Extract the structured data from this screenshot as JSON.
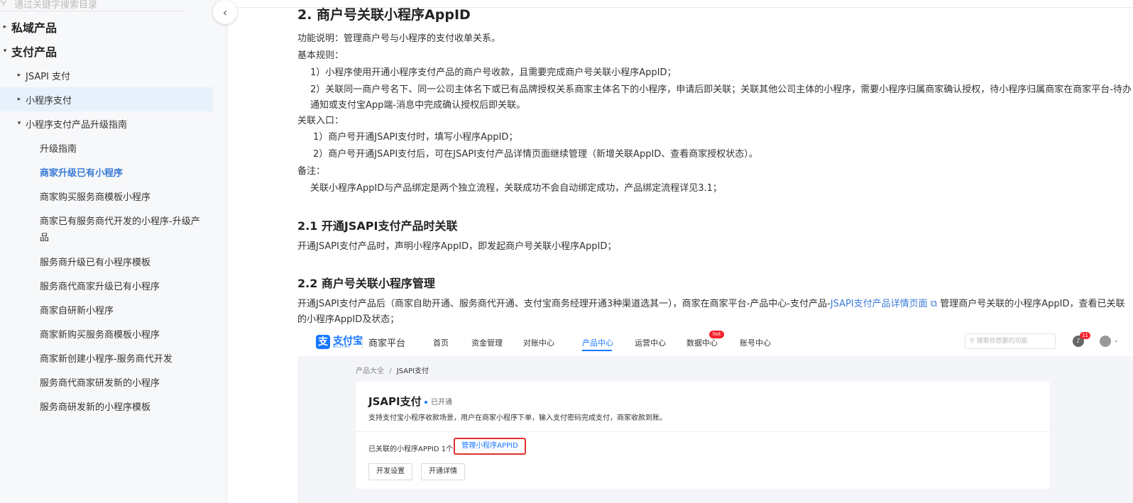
{
  "sidebar": {
    "search_placeholder": "通过关键字搜索目录",
    "items": [
      {
        "label": "私域产品",
        "level": 0,
        "caret": "▸"
      },
      {
        "label": "支付产品",
        "level": 0,
        "caret": "▾"
      },
      {
        "label": "JSAPI 支付",
        "level": 1,
        "caret": "▸"
      },
      {
        "label": "小程序支付",
        "level": 1,
        "caret": "▸"
      },
      {
        "label": "小程序支付产品升级指南",
        "level": 1,
        "caret": "▾"
      },
      {
        "label": "升级指南",
        "level": 2
      },
      {
        "label": "商家升级已有小程序",
        "level": 2
      },
      {
        "label": "商家购买服务商模板小程序",
        "level": 2
      },
      {
        "label": "商家已有服务商代开发的小程序-升级产品",
        "level": 2
      },
      {
        "label": "服务商升级已有小程序模板",
        "level": 2
      },
      {
        "label": "服务商代商家升级已有小程序",
        "level": 2
      },
      {
        "label": "商家自研新小程序",
        "level": 2
      },
      {
        "label": "商家新购买服务商模板小程序",
        "level": 2
      },
      {
        "label": "商家新创建小程序-服务商代开发",
        "level": 2
      },
      {
        "label": "服务商代商家研发新的小程序",
        "level": 2
      },
      {
        "label": "服务商研发新的小程序模板",
        "level": 2
      }
    ],
    "collapse_glyph": "‹"
  },
  "article": {
    "title": "2. 商户号关联小程序AppID",
    "func_desc": "功能说明：管理商户号与小程序的支付收单关系。",
    "basic_rules": "基本规则：",
    "rule1": "1）小程序使用开通小程序支付产品的商户号收款，且需要完成商户号关联小程序AppID；",
    "rule2": "2）关联同一商户号名下、同一公司主体名下或已有品牌授权关系商家主体名下的小程序，申请后即关联；关联其他公司主体的小程序，需要小程序归属商家确认授权，待小程序归属商家在商家平台-待办通知或支付宝App端-消息中完成确认授权后即关联。",
    "entry": "关联入口：",
    "entry1": "1）商户号开通JSAPI支付时，填写小程序AppID；",
    "entry2": "2）商户号开通JSAPI支付后，可在JSAPI支付产品详情页面继续管理（新增关联AppID、查看商家授权状态）。",
    "note": "备注：",
    "note_text": "关联小程序AppID与产品绑定是两个独立流程，关联成功不会自动绑定成功，产品绑定流程详见3.1；",
    "h21": "2.1 开通JSAPI支付产品时关联",
    "p21": "开通JSAPI支付产品时，声明小程序AppID，即发起商户号关联小程序AppID；",
    "h22": "2.2 商户号关联小程序管理",
    "p22_pre": "开通JSAPI支付产品后（商家自助开通、服务商代开通、支付宝商务经理开通3种渠道选其一），商家在商家平台-产品中心-支付产品-",
    "p22_link": "JSAPI支付产品详情页面",
    "p22_post": " 管理商户号关联的小程序AppID，查看已关联的小程序AppID及状态；"
  },
  "screenshot": {
    "logo_mark": "支",
    "logo_text": "支付宝",
    "logo_sub": "ALIPAY",
    "platform": "商家平台",
    "menu": [
      "首页",
      "资金管理",
      "对账中心",
      "产品中心",
      "运营中心",
      "数据中心",
      "账号中心"
    ],
    "hot_badge": "hot",
    "search_placeholder": "搜索你想要的功能",
    "bell_count": "11",
    "crumb_root": "产品大全",
    "crumb_sep": "/",
    "crumb_current": "JSAPI支付",
    "card_title": "JSAPI支付",
    "card_status": "已开通",
    "card_desc": "支持支付宝小程序收款场景，用户在商家小程序下单，输入支付密码完成支付，商家收款到账。",
    "assoc_label": "已关联的小程序APPID  1个",
    "manage_btn": "管理小程序APPID",
    "btn_dev": "开发设置",
    "btn_detail": "开通详情"
  }
}
